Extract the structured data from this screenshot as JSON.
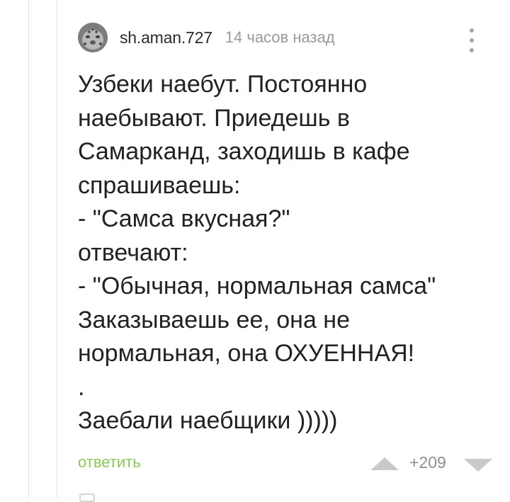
{
  "comment": {
    "author": "sh.aman.727",
    "timestamp": "14 часов назад",
    "lines": [
      "Узбеки наебут. Постоянно",
      "наебывают. Приедешь в",
      "Самарканд, заходишь в кафе",
      "спрашиваешь:",
      "- \"Самса вкусная?\"",
      "отвечают:",
      "- \"Обычная, нормальная самса\"",
      "Заказываешь ее, она не",
      "нормальная, она ОХУЕННАЯ!",
      ".",
      "Заебали наебщики )))))"
    ],
    "reply_label": "ответить",
    "rating": "+209"
  },
  "icons": {
    "avatar": "snow-leopard-avatar",
    "menu": "more-vertical-icon",
    "upvote": "triangle-up-icon",
    "downvote": "triangle-down-icon"
  },
  "colors": {
    "reply": "#8ac858",
    "muted": "#9a9a9a",
    "vote_arrow": "#c9c9c9",
    "text": "#222222"
  }
}
